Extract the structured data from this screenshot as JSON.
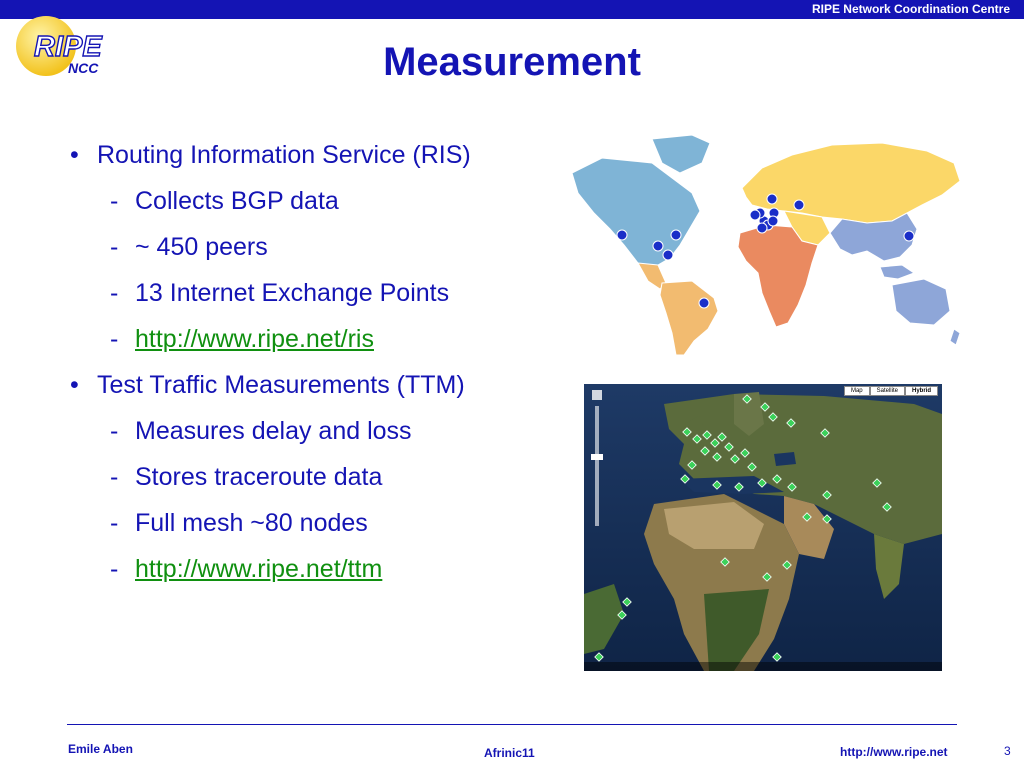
{
  "header": {
    "org": "RIPE Network Coordination Centre",
    "logo": {
      "main": "RIPE",
      "sub": "NCC"
    }
  },
  "title": "Measurement",
  "bullets": [
    {
      "text": "Routing Information Service (RIS)",
      "subitems": [
        {
          "text": "Collects BGP data"
        },
        {
          "text": "~ 450 peers"
        },
        {
          "text": "13 Internet Exchange Points"
        },
        {
          "text": "http://www.ripe.net/ris",
          "link": true
        }
      ]
    },
    {
      "text": "Test Traffic Measurements (TTM)",
      "subitems": [
        {
          "text": "Measures delay and loss"
        },
        {
          "text": "Stores traceroute data"
        },
        {
          "text": "Full mesh ~80 nodes"
        },
        {
          "text": "http://www.ripe.net/ttm",
          "link": true
        }
      ]
    }
  ],
  "satellite_map": {
    "buttons": [
      "Map",
      "Satellite",
      "Hybrid"
    ],
    "selected": "Hybrid"
  },
  "footer": {
    "author": "Emile Aben",
    "event": "Afrinic11",
    "url": "http://www.ripe.net",
    "page": "3"
  },
  "colors": {
    "brand": "#1414b4",
    "link": "#109010",
    "north_america": "#7fb4d6",
    "south_america": "#f2bb70",
    "europe_asia": "#fbd768",
    "africa": "#ea8a60",
    "south_asia_oceania": "#8ea6d8",
    "markers": "#1a2ec8"
  }
}
